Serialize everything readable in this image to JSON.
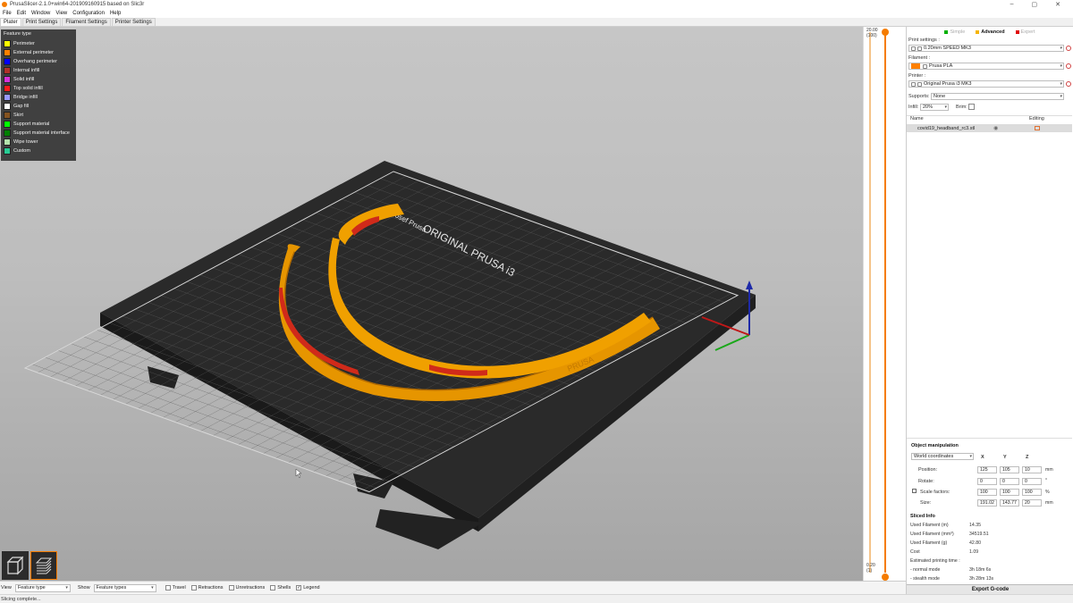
{
  "window": {
    "title": "PrusaSlicer-2.1.0+win64-201909160915 based on Slic3r",
    "controls": [
      "–",
      "▢",
      "✕"
    ]
  },
  "menu": [
    "File",
    "Edit",
    "Window",
    "View",
    "Configuration",
    "Help"
  ],
  "tabs": [
    "Plater",
    "Print Settings",
    "Filament Settings",
    "Printer Settings"
  ],
  "legend": {
    "title": "Feature type",
    "items": [
      {
        "label": "Perimeter",
        "color": "#ffff00"
      },
      {
        "label": "External perimeter",
        "color": "#ff8000"
      },
      {
        "label": "Overhang perimeter",
        "color": "#0000ff"
      },
      {
        "label": "Internal infill",
        "color": "#b03029"
      },
      {
        "label": "Solid infill",
        "color": "#d732d7"
      },
      {
        "label": "Top solid infill",
        "color": "#ff1a1a"
      },
      {
        "label": "Bridge infill",
        "color": "#9999ff"
      },
      {
        "label": "Gap fill",
        "color": "#ffffff"
      },
      {
        "label": "Skirt",
        "color": "#845321"
      },
      {
        "label": "Support material",
        "color": "#00ff00"
      },
      {
        "label": "Support material interface",
        "color": "#008000"
      },
      {
        "label": "Wipe tower",
        "color": "#b3e3ab"
      },
      {
        "label": "Custom",
        "color": "#28cc94"
      }
    ]
  },
  "plate": {
    "label1": "ORIGINAL PRUSA i3",
    "label2": "by Josef Prusa",
    "part_text": "PRUSA"
  },
  "layer_slider": {
    "top_value": "20.00",
    "top_layer": "(100)",
    "bottom_value": "0.20",
    "bottom_layer": "(1)"
  },
  "sidebar": {
    "modes": [
      {
        "label": "Simple",
        "color": "#00b000",
        "active": false
      },
      {
        "label": "Advanced",
        "color": "#f5b400",
        "active": true
      },
      {
        "label": "Expert",
        "color": "#e00000",
        "active": false
      }
    ],
    "print_settings_label": "Print settings :",
    "print_settings_value": "0.20mm SPEED MK3",
    "filament_label": "Filament :",
    "filament_value": "Prusa PLA",
    "filament_color": "#ff8000",
    "printer_label": "Printer :",
    "printer_value": "Original Prusa i3 MK3",
    "supports_label": "Supports:",
    "supports_value": "None",
    "infill_label": "Infill:",
    "infill_value": "20%",
    "brim_label": "Brim:",
    "list_name_header": "Name",
    "list_editing_header": "Editing",
    "object_name": "covid19_headband_rc3.stl",
    "object_manipulation": {
      "title": "Object manipulation",
      "coords": "World coordinates",
      "axis_x": "X",
      "axis_y": "Y",
      "axis_z": "Z",
      "position_label": "Position:",
      "position": [
        "125",
        "105",
        "10"
      ],
      "position_unit": "mm",
      "rotate_label": "Rotate:",
      "rotate": [
        "0",
        "0",
        "0"
      ],
      "rotate_unit": "°",
      "scale_label": "Scale factors:",
      "scale": [
        "100",
        "100",
        "100"
      ],
      "scale_unit": "%",
      "size_label": "Size:",
      "size": [
        "191.02",
        "143.77",
        "20"
      ],
      "size_unit": "mm"
    },
    "sliced_info": {
      "title": "Sliced Info",
      "rows": [
        {
          "label": "Used Filament (m)",
          "value": "14.35"
        },
        {
          "label": "Used Filament (mm³)",
          "value": "34519.51"
        },
        {
          "label": "Used Filament (g)",
          "value": "42.80"
        },
        {
          "label": "Cost",
          "value": "1.09"
        },
        {
          "label": "Estimated printing time :",
          "value": ""
        },
        {
          "label": " - normal mode",
          "value": "3h 18m 6s"
        },
        {
          "label": " - stealth mode",
          "value": "3h 28m 13s"
        }
      ]
    },
    "export_label": "Export G-code"
  },
  "bottom": {
    "view_label": "View",
    "view_value": "Feature type",
    "show_label": "Show",
    "show_value": "Feature types",
    "checks": [
      {
        "label": "Travel",
        "checked": false
      },
      {
        "label": "Retractions",
        "checked": false
      },
      {
        "label": "Unretractions",
        "checked": false
      },
      {
        "label": "Shells",
        "checked": false
      },
      {
        "label": "Legend",
        "checked": true
      }
    ]
  },
  "status": "Slicing complete..."
}
